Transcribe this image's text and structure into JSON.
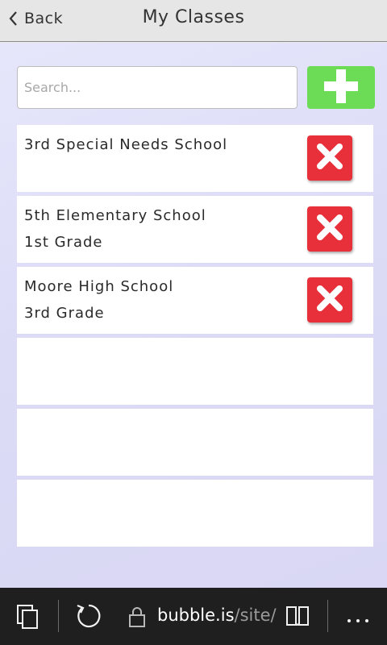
{
  "header": {
    "back_label": "Back",
    "title": "My Classes"
  },
  "search": {
    "placeholder": "Search...",
    "value": ""
  },
  "classes": [
    {
      "school": "3rd Special Needs School",
      "grade": ""
    },
    {
      "school": "5th Elementary School",
      "grade": "1st Grade"
    },
    {
      "school": "Moore High School",
      "grade": "3rd Grade"
    },
    {
      "school": "",
      "grade": ""
    },
    {
      "school": "",
      "grade": ""
    },
    {
      "school": "",
      "grade": ""
    }
  ],
  "browser": {
    "domain": "bubble.is",
    "path": "/site/"
  },
  "icons": {
    "back": "chevron-left-icon",
    "add": "plus-icon",
    "delete": "close-x-icon",
    "tabs": "tabs-icon",
    "refresh": "refresh-icon",
    "lock": "lock-icon",
    "reading": "book-icon",
    "more": "more-icon"
  },
  "colors": {
    "add_button": "#6cdc57",
    "delete_button": "#e8303a",
    "background": "#dcdcf7"
  }
}
